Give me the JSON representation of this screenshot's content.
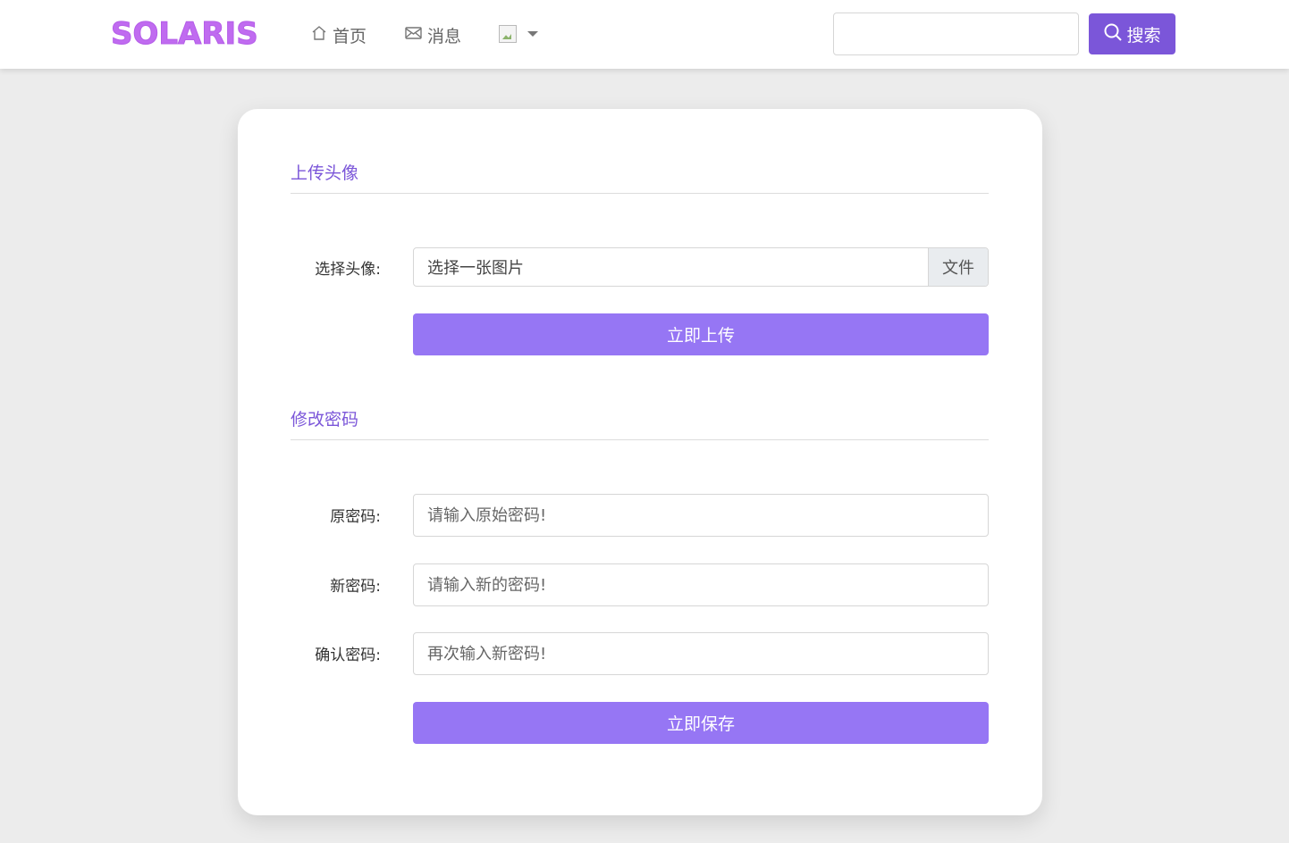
{
  "navbar": {
    "logo": "SOLARIS",
    "home_label": "首页",
    "messages_label": "消息",
    "search_placeholder": "",
    "search_button_label": "搜索"
  },
  "colors": {
    "accent": "#7b56d9",
    "button": "#9676f4",
    "logo": "#c06bf0",
    "background": "#ececec"
  },
  "icons": {
    "home": "home-icon",
    "messages": "envelope-icon",
    "search": "search-icon",
    "avatar": "broken-image-icon",
    "caret": "caret-down-icon"
  },
  "avatar_section": {
    "title": "上传头像",
    "choose_label": "选择头像:",
    "file_placeholder": "选择一张图片",
    "file_button": "文件",
    "upload_button": "立即上传"
  },
  "password_section": {
    "title": "修改密码",
    "old_label": "原密码:",
    "old_placeholder": "请输入原始密码!",
    "new_label": "新密码:",
    "new_placeholder": "请输入新的密码!",
    "confirm_label": "确认密码:",
    "confirm_placeholder": "再次输入新密码!",
    "save_button": "立即保存"
  }
}
